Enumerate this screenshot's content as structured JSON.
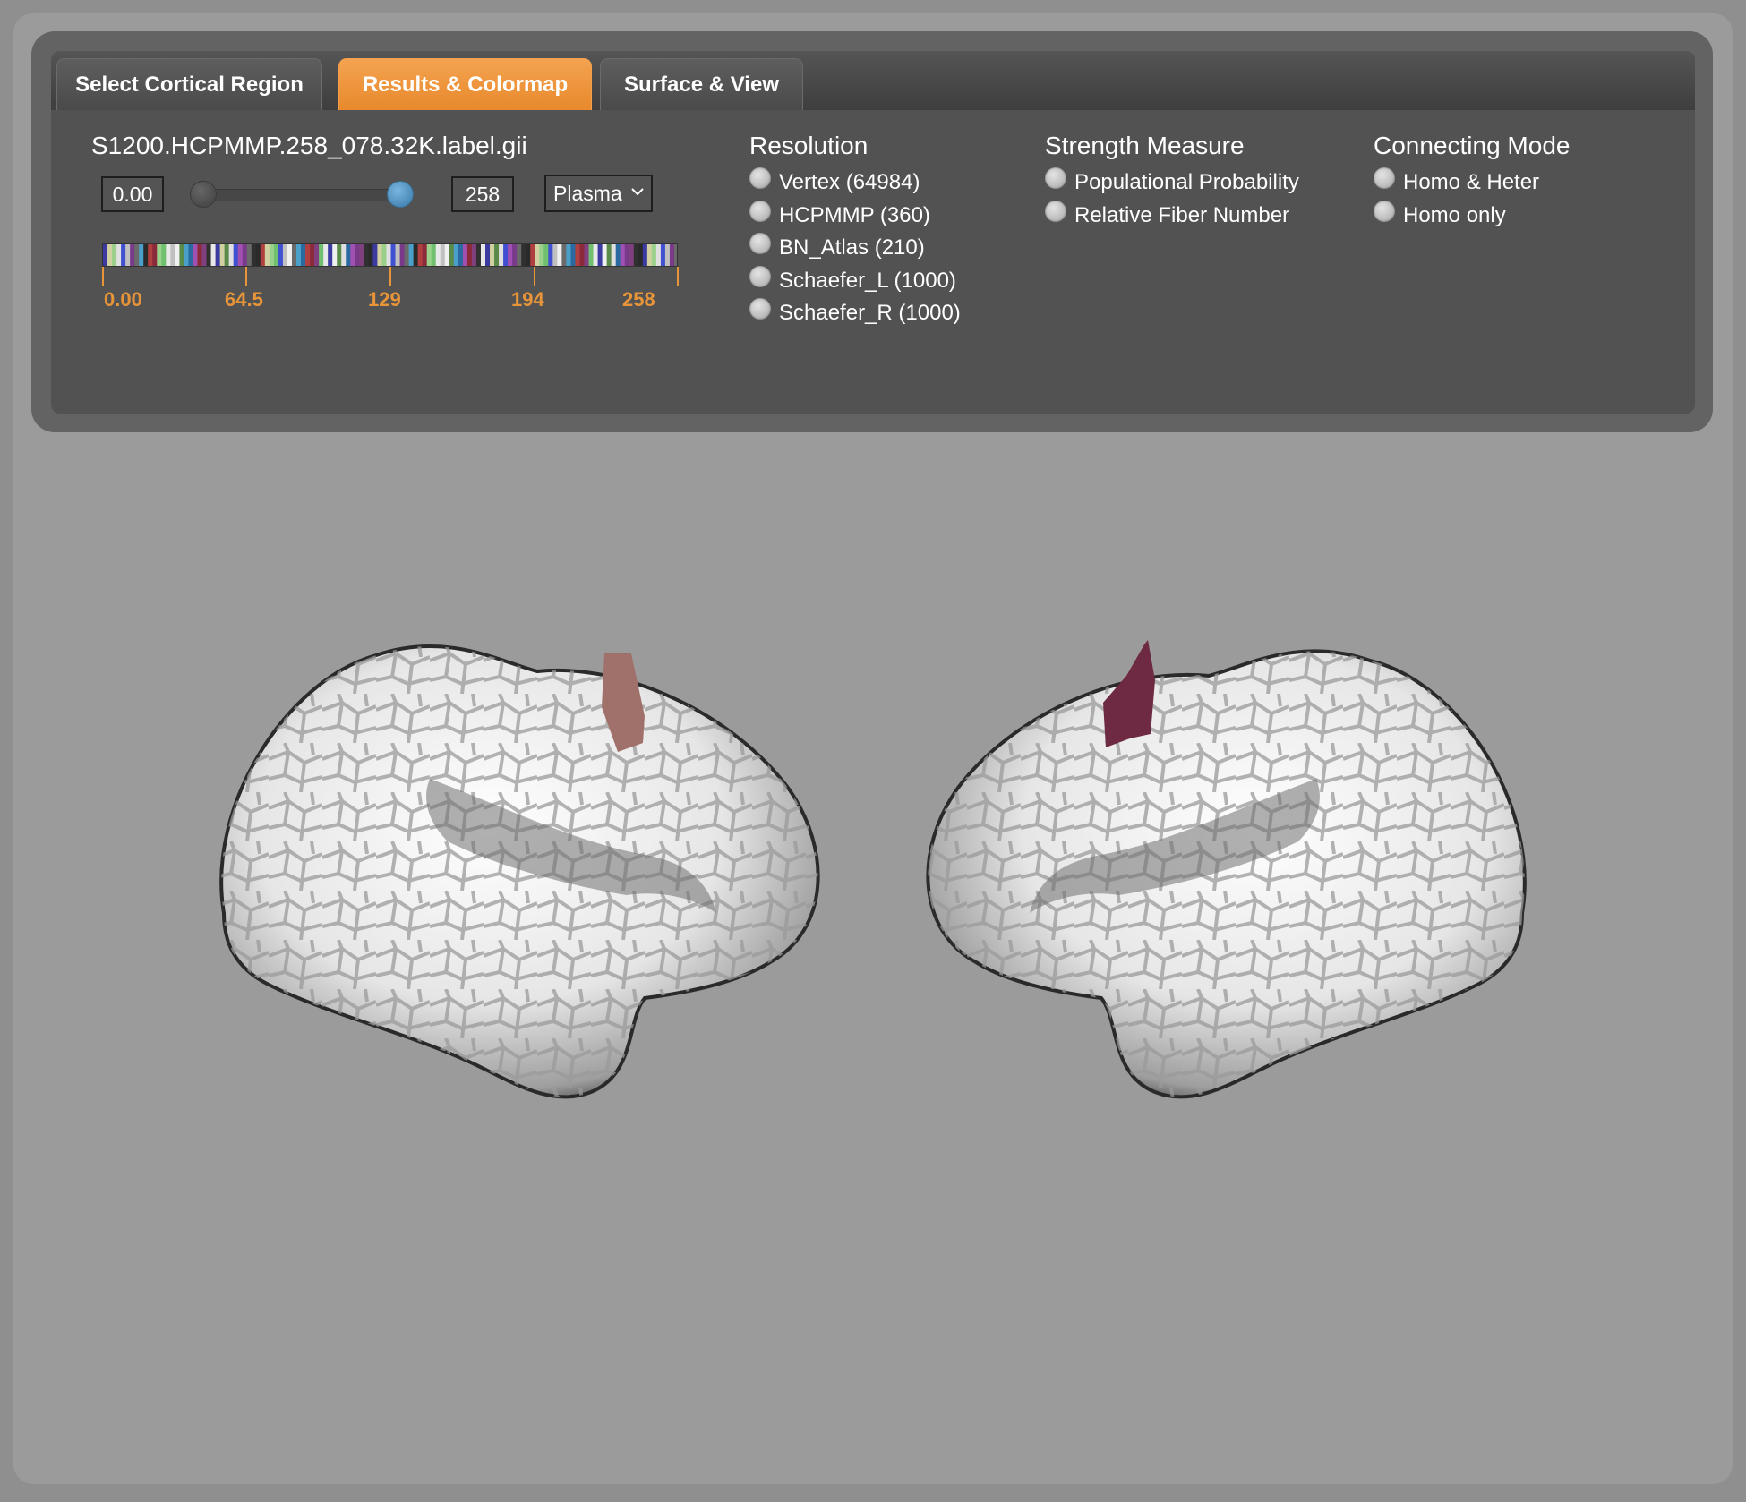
{
  "tabs": [
    {
      "label": "Select Cortical Region",
      "active": false
    },
    {
      "label": "Results & Colormap",
      "active": true
    },
    {
      "label": "Surface & View",
      "active": false
    }
  ],
  "results": {
    "file_name": "S1200.HCPMMP.258_078.32K.label.gii",
    "min_value": "0.00",
    "max_value": "258",
    "range_min_fraction": 0.0,
    "range_max_fraction": 1.0,
    "colormap_selected": "Plasma",
    "colorbar_ticks": [
      "0.00",
      "64.5",
      "129",
      "194",
      "258"
    ]
  },
  "resolution": {
    "title": "Resolution",
    "options": [
      "Vertex (64984)",
      "HCPMMP (360)",
      "BN_Atlas (210)",
      "Schaefer_L (1000)",
      "Schaefer_R (1000)"
    ]
  },
  "strength": {
    "title": "Strength Measure",
    "options": [
      "Populational Probability",
      "Relative Fiber Number"
    ]
  },
  "connecting": {
    "title": "Connecting Mode",
    "options": [
      "Homo & Heter",
      "Homo only"
    ]
  },
  "colors": {
    "accent": "#e8892c",
    "tick_color": "#e8953a",
    "panel_bg": "#525252",
    "highlight_left": "#a0706a",
    "highlight_right": "#6e2a42",
    "slider_handle_max": "#4a8ab8"
  },
  "icons": {
    "dropdown": "chevron-down-icon"
  }
}
